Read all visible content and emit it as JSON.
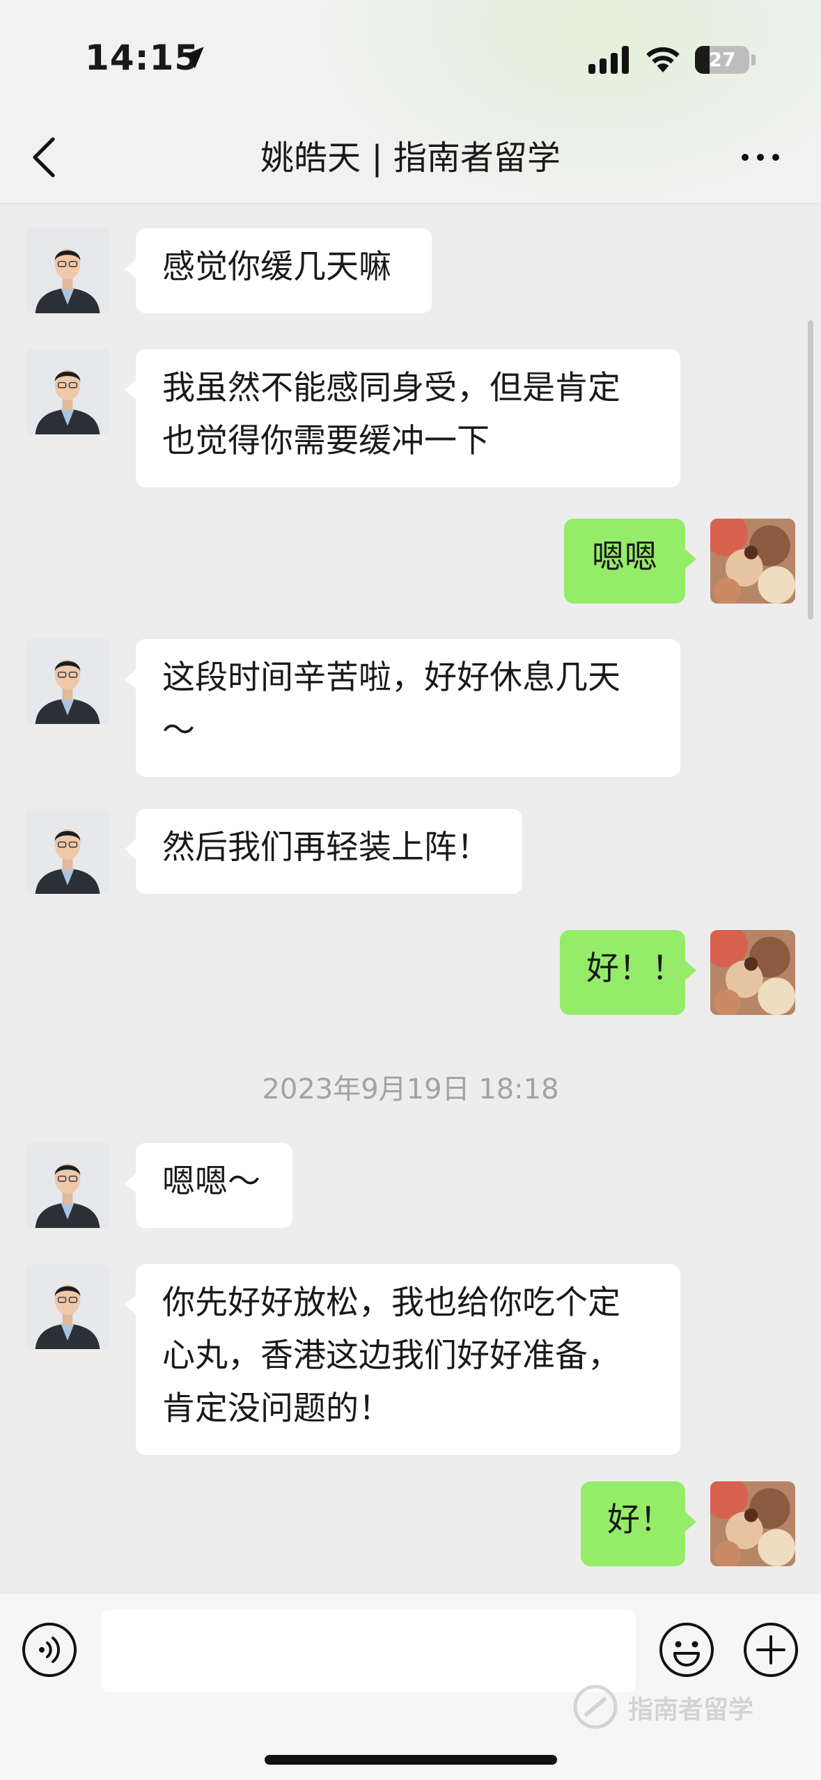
{
  "status_bar": {
    "time": "14:15",
    "battery": "27",
    "battery_level_pct": 27
  },
  "header": {
    "title": "姚皓天 | 指南者留学"
  },
  "messages": [
    {
      "side": "in",
      "text": "感觉你缓几天嘛"
    },
    {
      "side": "in",
      "text": "我虽然不能感同身受，但是肯定\n也觉得你需要缓冲一下"
    },
    {
      "side": "out",
      "text": "嗯嗯"
    },
    {
      "side": "in",
      "text": "这段时间辛苦啦，好好休息几天\n～"
    },
    {
      "side": "in",
      "text": "然后我们再轻装上阵！"
    },
    {
      "side": "out",
      "text": "好！！"
    },
    {
      "side": "in",
      "text": "嗯嗯～"
    },
    {
      "side": "in",
      "text": "你先好好放松，我也给你吃个定\n心丸，香港这边我们好好准备，\n肯定没问题的！"
    },
    {
      "side": "out",
      "text": "好！"
    }
  ],
  "timestamp": "2023年9月19日 18:18",
  "input": {
    "value": "",
    "placeholder": ""
  },
  "watermark": {
    "text": "指南者留学"
  },
  "icons": {
    "back": "chevron-left-icon",
    "more": "more-dots-icon",
    "voice": "voice-icon",
    "emoji": "emoji-icon",
    "plus": "plus-icon"
  },
  "colors": {
    "outgoing_bubble": "#95ec69",
    "incoming_bubble": "#ffffff",
    "background": "#ededed"
  }
}
